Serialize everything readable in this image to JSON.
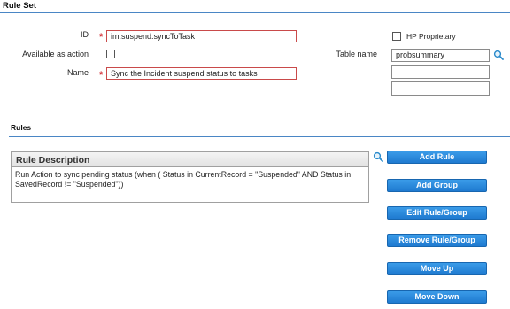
{
  "header": {
    "title": "Rule Set"
  },
  "form": {
    "id_label": "ID",
    "id_value": "im.suspend.syncToTask",
    "available_label": "Available as action",
    "name_label": "Name",
    "name_value": "Sync the Incident suspend status to tasks",
    "hp_proprietary_label": "HP Proprietary",
    "table_name_label": "Table name",
    "table_name_values": [
      "probsummary",
      "",
      ""
    ]
  },
  "rules": {
    "section_title": "Rules",
    "column_header": "Rule Description",
    "items": [
      "Run Action to sync pending status (when ( Status in CurrentRecord = \"Suspended\" AND Status in SavedRecord != \"Suspended\"))"
    ]
  },
  "buttons": {
    "add_rule": "Add Rule",
    "add_group": "Add Group",
    "edit_rule_group": "Edit Rule/Group",
    "remove_rule_group": "Remove Rule/Group",
    "move_up": "Move Up",
    "move_down": "Move Down"
  },
  "colors": {
    "accent": "#1f7ad0",
    "section_line": "#4a86c5",
    "required": "#d2232a"
  },
  "icons": [
    "search-icon"
  ]
}
